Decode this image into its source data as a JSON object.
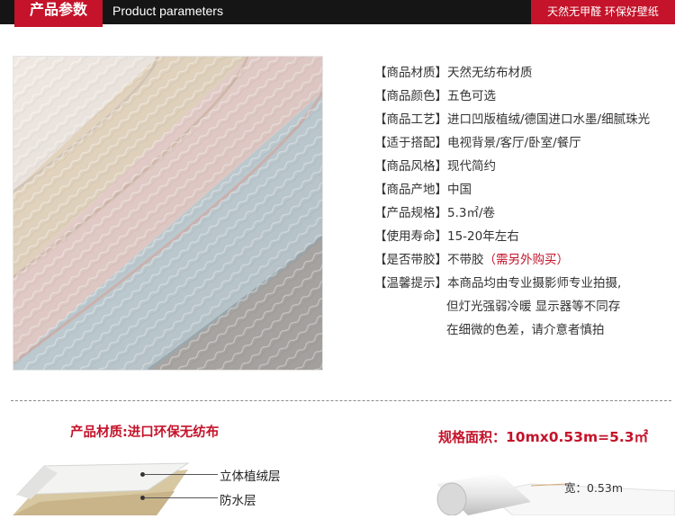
{
  "header": {
    "title_cn": "产品参数",
    "title_en": "Product parameters",
    "slogan": "天然无甲醛 环保好壁纸",
    "accent": "#c4132a",
    "bar_color": "#151515"
  },
  "photo": {
    "icon": "wallpaper-rolls-photo"
  },
  "specs": [
    {
      "key": "【商品材质】",
      "value": "天然无纺布材质"
    },
    {
      "key": "【商品颜色】",
      "value": "五色可选"
    },
    {
      "key": "【商品工艺】",
      "value": "进口凹版植绒/德国进口水墨/细腻珠光"
    },
    {
      "key": "【适于搭配】",
      "value": "电视背景/客厅/卧室/餐厅"
    },
    {
      "key": "【商品风格】",
      "value": "现代简约"
    },
    {
      "key": "【商品产地】",
      "value": "中国"
    },
    {
      "key": "【产品规格】",
      "value": "5.3㎡/卷"
    },
    {
      "key": "【使用寿命】",
      "value": "15-20年左右"
    },
    {
      "key": "【是否带胶】",
      "value": "不带胶",
      "note": "（需另外购买）"
    },
    {
      "key": "【温馨提示】",
      "value": "本商品均由专业摄影师专业拍摄,"
    }
  ],
  "notes_cont": [
    "但灯光强弱冷暖 显示器等不同存",
    "在细微的色差，请介意者慎拍"
  ],
  "material": {
    "title": "产品材质:进口环保无纺布",
    "layers": [
      "立体植绒层",
      "防水层"
    ]
  },
  "size": {
    "title": "规格面积：",
    "formula": "10mx0.53m=5.3㎡",
    "width_label": "宽：0.53m"
  }
}
